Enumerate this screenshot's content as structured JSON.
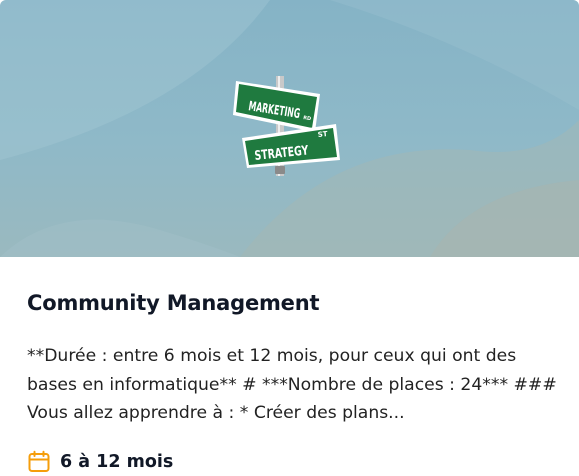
{
  "card": {
    "image": {
      "sign_top": "MARKETING",
      "sign_top_suffix": "RD",
      "sign_bottom": "STRATEGY",
      "sign_bottom_suffix": "ST"
    },
    "title": "Community Management",
    "description": "**Durée : entre 6 mois et 12 mois, pour ceux qui ont des bases en informatique** # ***Nombre de places : 24*** ### Vous allez apprendre à : * Créer des plans...",
    "duration": {
      "icon": "calendar-icon",
      "label": "6 à 12 mois"
    }
  },
  "colors": {
    "sign_green": "#1f7a3f",
    "icon_accent": "#f59e0b"
  }
}
